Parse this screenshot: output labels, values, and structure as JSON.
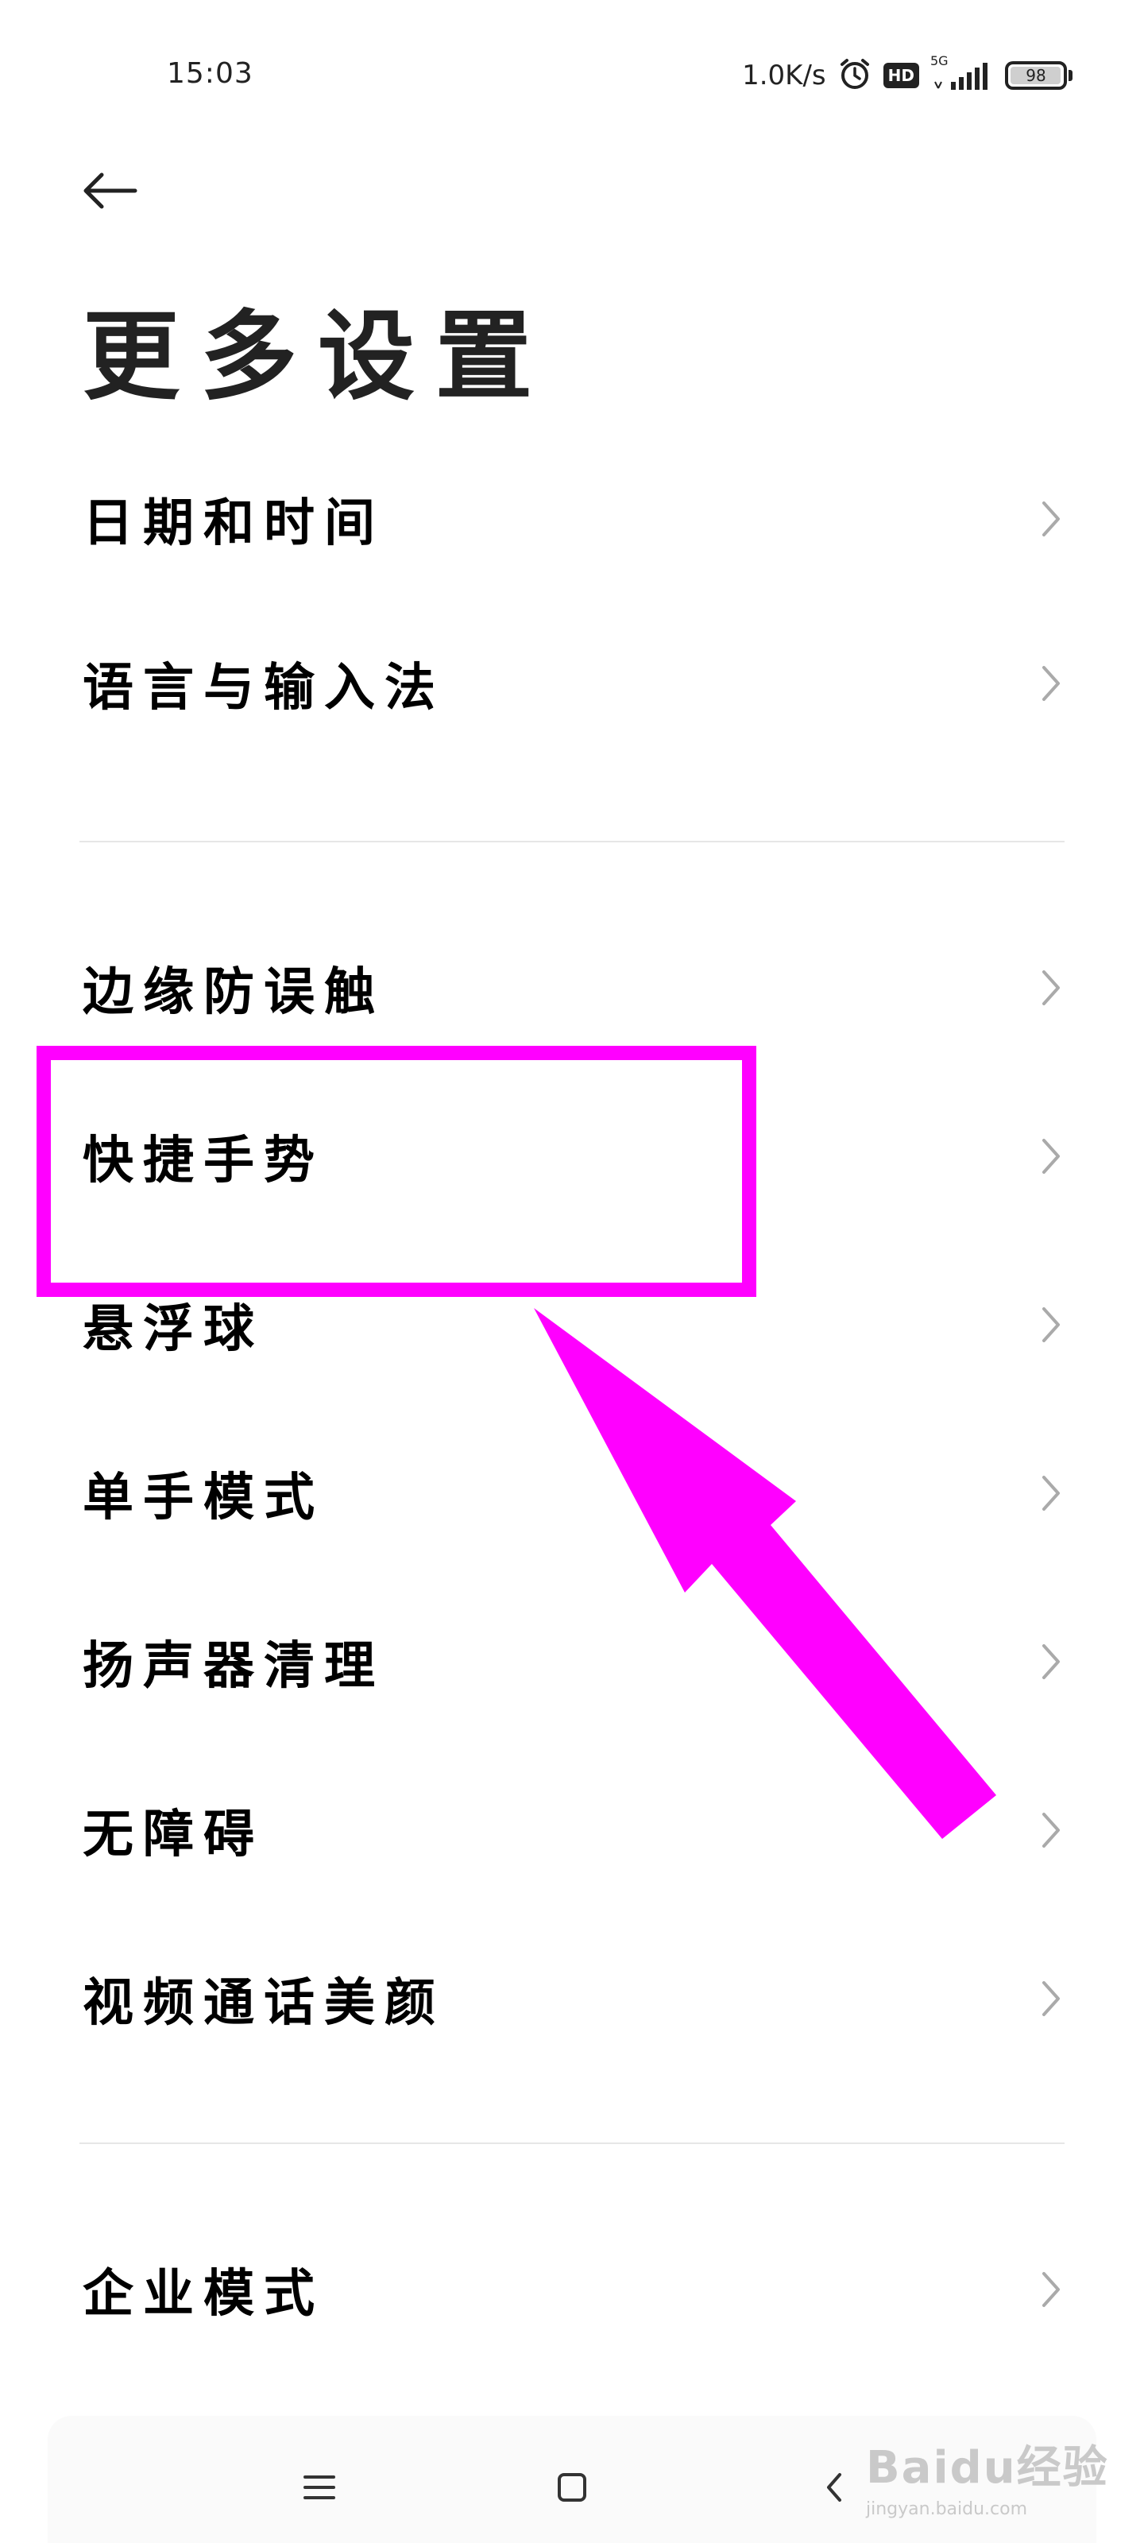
{
  "status": {
    "time": "15:03",
    "net_speed": "1.0K/s",
    "hd": "HD",
    "network_type": "5G",
    "battery": "98",
    "battery_level": 0.98,
    "icons": [
      "alarm-icon",
      "hd-icon",
      "signal-5g-icon",
      "battery-icon"
    ]
  },
  "header": {
    "back_icon": "arrow-left-icon",
    "title": "更多设置"
  },
  "sections": [
    {
      "items": [
        {
          "label": "日期和时间"
        },
        {
          "label": "语言与输入法"
        }
      ]
    },
    {
      "items": [
        {
          "label": "边缘防误触"
        },
        {
          "label": "快捷手势"
        },
        {
          "label": "悬浮球"
        },
        {
          "label": "单手模式"
        },
        {
          "label": "扬声器清理"
        },
        {
          "label": "无障碍"
        },
        {
          "label": "视频通话美颜"
        }
      ]
    },
    {
      "items": [
        {
          "label": "企业模式"
        }
      ]
    }
  ],
  "annotation": {
    "highlight_color": "#ff00ff",
    "highlighted_item": "快捷手势"
  },
  "nav_bar": {
    "icons": [
      "menu-icon",
      "home-icon",
      "back-icon"
    ]
  },
  "watermark": {
    "logo": "Baidu经验",
    "url": "jingyan.baidu.com"
  }
}
